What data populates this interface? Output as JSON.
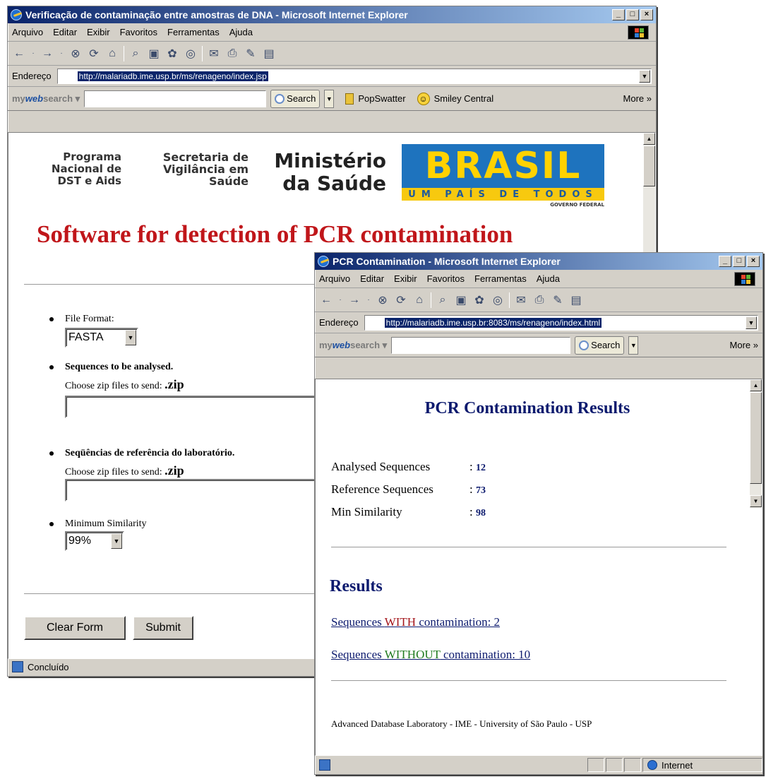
{
  "back_window": {
    "title": "Verificação de contaminação entre amostras de DNA - Microsoft Internet Explorer",
    "window_buttons": [
      "_",
      "□",
      "×"
    ],
    "menu": [
      "Arquivo",
      "Editar",
      "Exibir",
      "Favoritos",
      "Ferramentas",
      "Ajuda"
    ],
    "address_label": "Endereço",
    "address_url": "http://malariadb.ime.usp.br/ms/renageno/index.jsp",
    "searchbar": {
      "brand_prefix": "my",
      "brand_bold": "web",
      "brand_suffix": "search",
      "search_button": "Search",
      "popswatter": "PopSwatter",
      "smiley": "Smiley Central",
      "more": "More"
    },
    "logos": {
      "program": "Programa Nacional de DST e Aids",
      "program_lines": [
        "Programa",
        "Nacional de",
        "DST e Aids"
      ],
      "secretaria_lines": [
        "Secretaria de",
        "Vigilância em",
        "Saúde"
      ],
      "ministerio_lines": [
        "Ministério",
        "da Saúde"
      ],
      "brasil_word": "BRASIL",
      "brasil_tagline": "UM PAÍS DE TODOS",
      "brasil_gov": "GOVERNO FEDERAL"
    },
    "heading": "Software for detection of PCR contamination",
    "form": {
      "file_format_label": "File Format:",
      "file_format_value": "FASTA",
      "sequences_label": "Sequences to be analysed.",
      "choose_zip_1": "Choose zip files to send: ",
      "zip_ext_1": ".zip",
      "reference_label": "Seqüências de referência do laboratório.",
      "choose_zip_2": "Choose zip files to send: ",
      "zip_ext_2": ".zip",
      "min_similarity_label": "Minimum Similarity",
      "min_similarity_value": "99%",
      "clear_button": "Clear Form",
      "submit_button": "Submit"
    },
    "status": "Concluído"
  },
  "front_window": {
    "title": "PCR Contamination - Microsoft Internet Explorer",
    "window_buttons": [
      "_",
      "□",
      "×"
    ],
    "menu": [
      "Arquivo",
      "Editar",
      "Exibir",
      "Favoritos",
      "Ferramentas",
      "Ajuda"
    ],
    "address_label": "Endereço",
    "address_url": "http://malariadb.ime.usp.br:8083/ms/renageno/index.html",
    "searchbar": {
      "brand_prefix": "my",
      "brand_bold": "web",
      "brand_suffix": "search",
      "search_button": "Search",
      "more": "More"
    },
    "heading": "PCR Contamination Results",
    "summary": [
      {
        "label": "Analysed Sequences",
        "value": "12"
      },
      {
        "label": "Reference Sequences",
        "value": "73"
      },
      {
        "label": "Min Similarity",
        "value": "98"
      }
    ],
    "results_heading": "Results",
    "with_link": {
      "prefix": "Sequences ",
      "keyword": "WITH",
      "suffix": " contamination: 2"
    },
    "without_link": {
      "prefix": "Sequences ",
      "keyword": "WITHOUT",
      "suffix": " contamination: 10"
    },
    "footer": "Advanced Database Laboratory - IME - University of São Paulo - USP",
    "status_zone": "Internet"
  },
  "colors": {
    "title_gradient_start": "#0a246a",
    "heading_red": "#c0161a",
    "heading_navy": "#0c1a6e",
    "with_red": "#a3141a",
    "without_green": "#1f7a1f"
  }
}
